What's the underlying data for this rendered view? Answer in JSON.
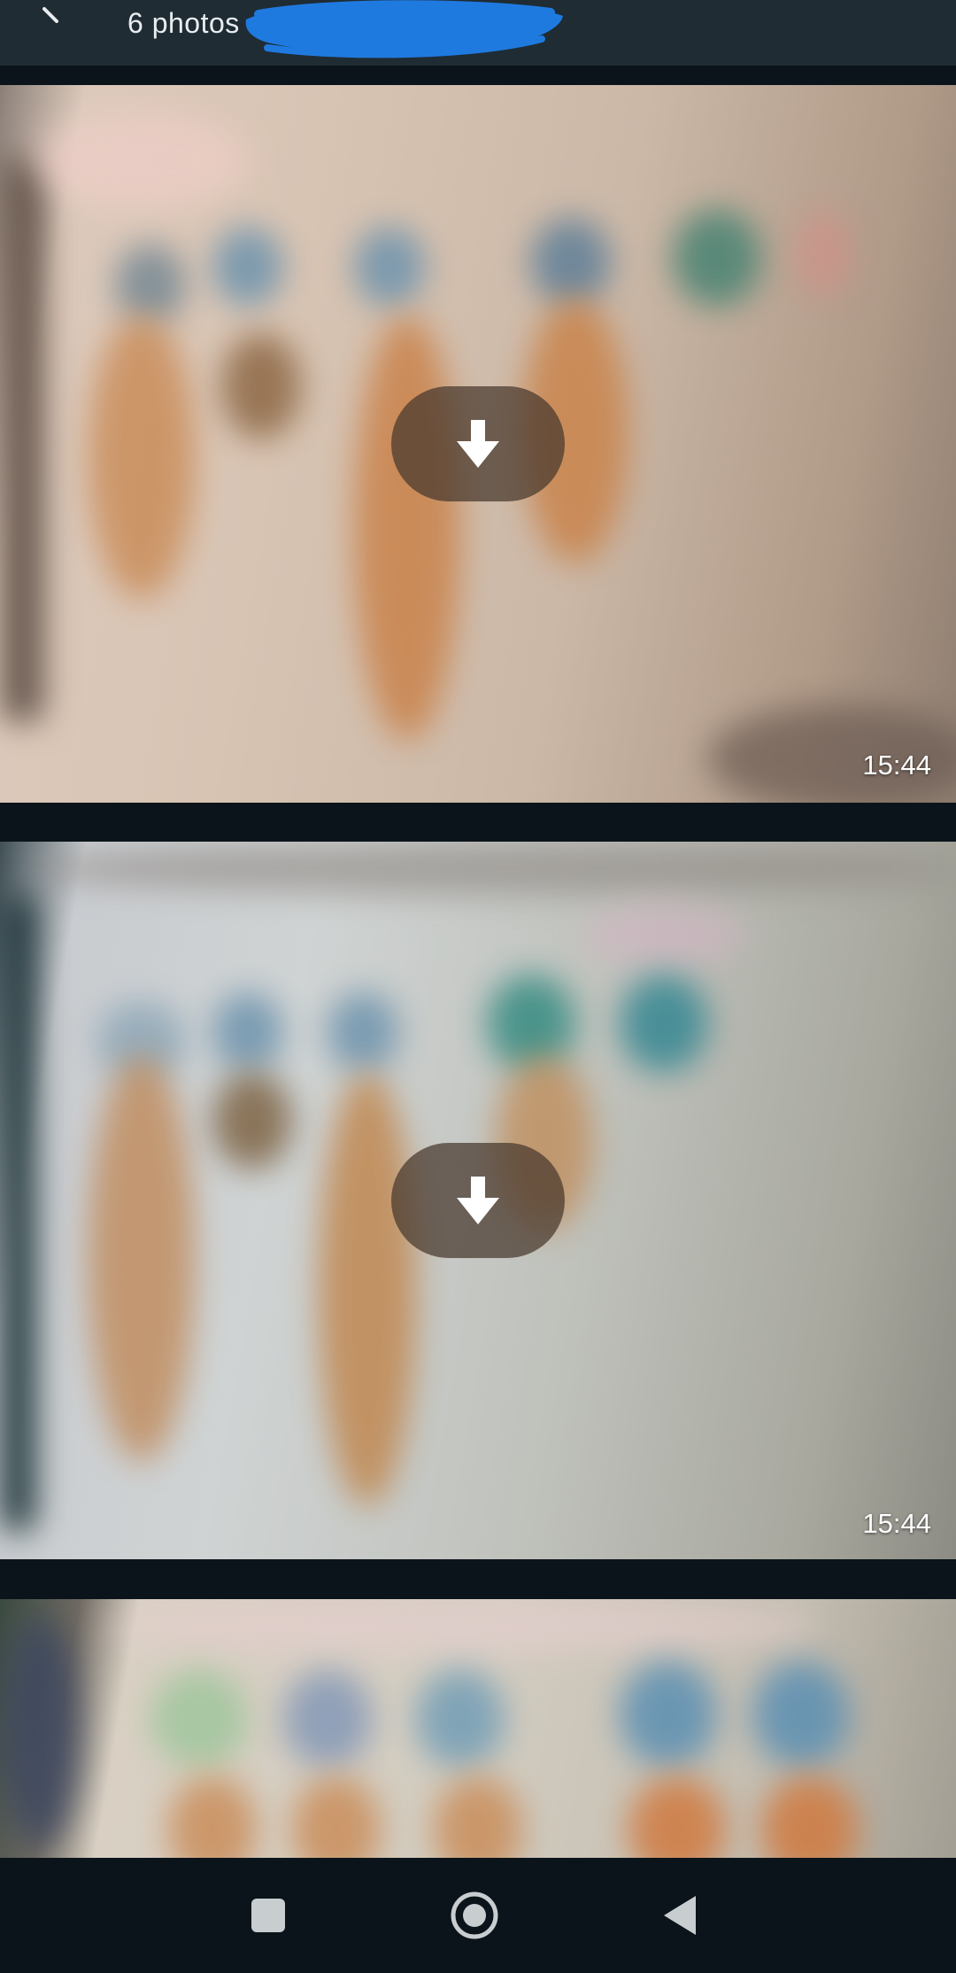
{
  "header": {
    "subtitle": "6 photos • 2",
    "redaction_color": "#1f7ae0"
  },
  "photos": [
    {
      "timestamp": "15:44",
      "download_icon": "download-arrow-icon"
    },
    {
      "timestamp": "15:44",
      "download_icon": "download-arrow-icon"
    },
    {
      "timestamp": ""
    }
  ],
  "navbar": {
    "buttons": [
      "recents-square-icon",
      "home-circle-icon",
      "back-triangle-icon"
    ]
  }
}
